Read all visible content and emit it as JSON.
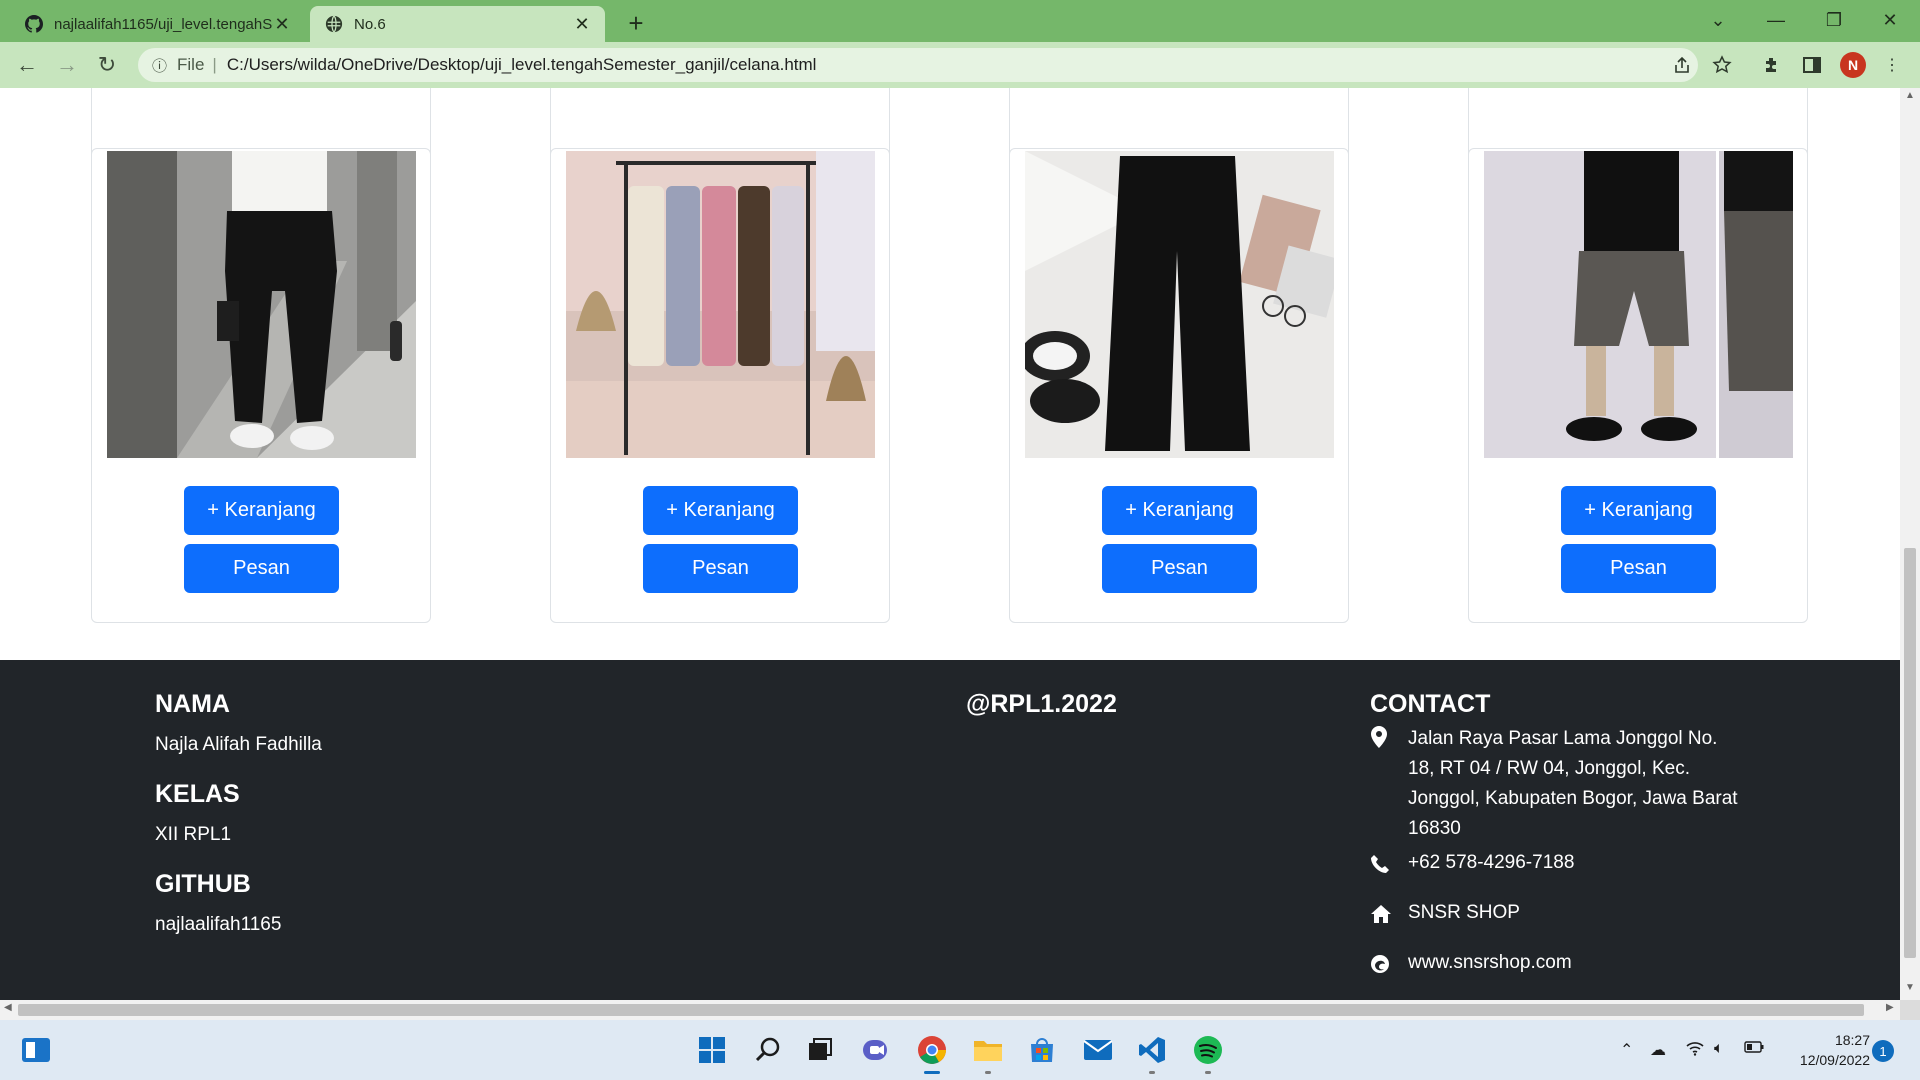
{
  "browser": {
    "tabs": [
      {
        "title": "najlaalifah1165/uji_level.tengahSemester_ganjil",
        "active": false
      },
      {
        "title": "No.6",
        "active": true
      }
    ],
    "address": {
      "scheme_label": "File",
      "url": "C:/Users/wilda/OneDrive/Desktop/uji_level.tengahSemester_ganjil/celana.html"
    },
    "profile_initial": "N"
  },
  "products": [
    {
      "photo": "black-cargo-jogger-pants",
      "cart_label": "+ Keranjang",
      "order_label": "Pesan"
    },
    {
      "photo": "cargo-pants-on-rack",
      "cart_label": "+ Keranjang",
      "order_label": "Pesan"
    },
    {
      "photo": "black-wide-leg-pants",
      "cart_label": "+ Keranjang",
      "order_label": "Pesan"
    },
    {
      "photo": "grey-cargo-shorts",
      "cart_label": "+ Keranjang",
      "order_label": "Pesan"
    }
  ],
  "footer": {
    "nama": {
      "heading": "NAMA",
      "value": "Najla Alifah Fadhilla"
    },
    "kelas": {
      "heading": "KELAS",
      "value": "XII RPL1"
    },
    "github": {
      "heading": "GITHUB",
      "value": "najlaalifah1165"
    },
    "center": "@RPL1.2022",
    "contact": {
      "heading": "CONTACT",
      "address": "Jalan Raya Pasar Lama Jonggol No. 18, RT 04 / RW 04, Jonggol, Kec. Jonggol, Kabupaten Bogor, Jawa Barat 16830",
      "phone": "+62 578-4296-7188",
      "shop": "SNSR SHOP",
      "website": "www.snsrshop.com"
    }
  },
  "taskbar": {
    "time": "18:27",
    "date": "12/09/2022",
    "notifications": "1"
  },
  "colors": {
    "primary_button": "#0d6efd",
    "footer_bg": "#212529",
    "tabstrip": "#75b76a",
    "toolbar": "#c7e5be"
  }
}
